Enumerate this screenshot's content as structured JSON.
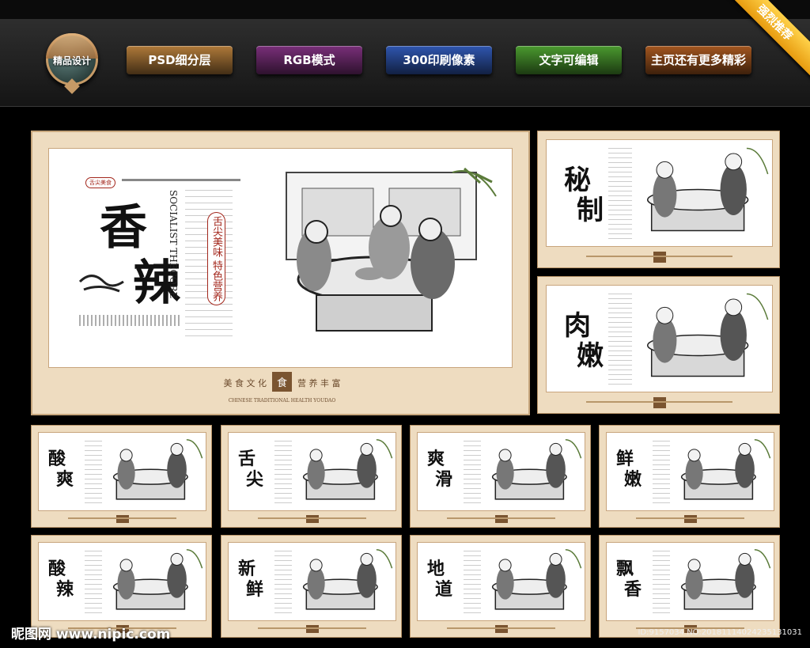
{
  "toolbar": {
    "badge_label": "精品设计",
    "buttons": [
      {
        "label": "PSD细分层",
        "color": "#b07a3a"
      },
      {
        "label": "RGB模式",
        "color": "#7a2f7a"
      },
      {
        "label": "300印刷像素",
        "color": "#2f56b0"
      },
      {
        "label": "文字可编辑",
        "color": "#4b9a2f"
      },
      {
        "label": "主页还有更多精彩",
        "color": "#a3561f"
      }
    ],
    "ribbon": "强烈推荐"
  },
  "main_panel": {
    "title_chars": [
      "香",
      "辣"
    ],
    "tag": "舌尖美食",
    "english_vertical": "SOCIALIST THECORE",
    "vertical_slogan": "舌尖美味 特色营养",
    "footer_left": "美 食 文 化",
    "footer_seal": "食",
    "footer_right": "营 养 丰 富",
    "footer_english": "CHINESE TRADITIONAL HEALTH YOUDAO"
  },
  "small_panels": [
    {
      "chars": [
        "秘",
        "制"
      ]
    },
    {
      "chars": [
        "肉",
        "嫩"
      ]
    },
    {
      "chars": [
        "酸",
        "爽"
      ]
    },
    {
      "chars": [
        "舌",
        "尖"
      ]
    },
    {
      "chars": [
        "爽",
        "滑"
      ]
    },
    {
      "chars": [
        "鲜",
        "嫩"
      ]
    },
    {
      "chars": [
        "酸",
        "辣"
      ]
    },
    {
      "chars": [
        "新",
        "鲜"
      ]
    },
    {
      "chars": [
        "地",
        "道"
      ]
    },
    {
      "chars": [
        "飘",
        "香"
      ]
    }
  ],
  "watermark": "昵图网 www.nipic.com",
  "image_id": "ID:9157034 NO:20181114024235131031",
  "colors": {
    "panel_bg": "#eedcc0",
    "frame": "#c7a67c",
    "seal_red": "#a3271c"
  }
}
